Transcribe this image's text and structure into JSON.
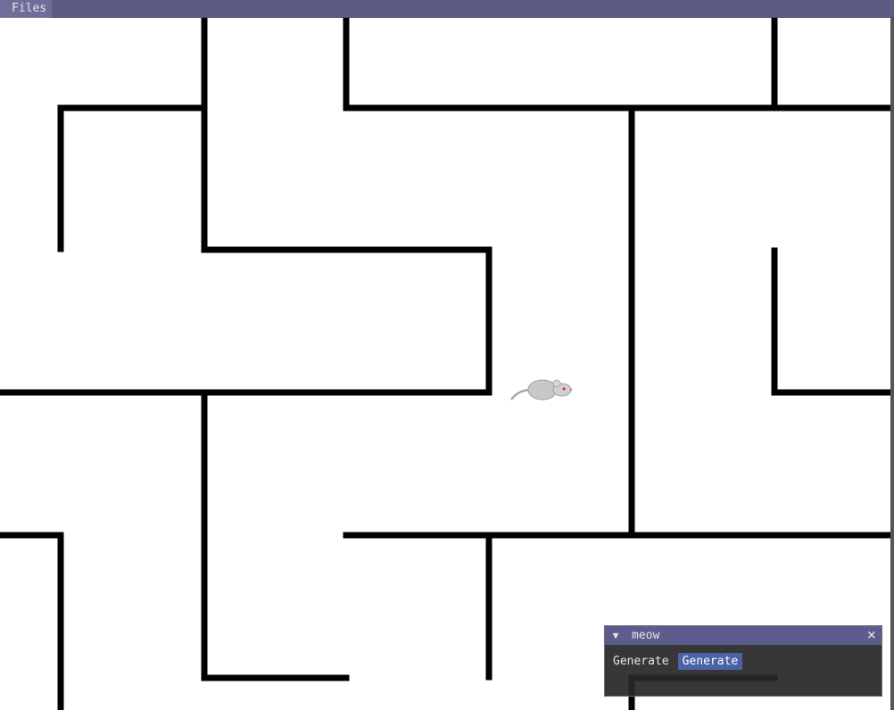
{
  "menubar": {
    "files_label": "Files"
  },
  "panel": {
    "title": "meow",
    "collapse_icon": "▼",
    "close_icon": "×",
    "label": "Generate",
    "button_label": "Generate"
  },
  "maze": {
    "grid": {
      "cols": 7,
      "rows": 5
    },
    "wall_color": "#000000",
    "background_color": "#ffffff",
    "mouse": {
      "col": 3,
      "row": 2,
      "facing": "right",
      "body_color": "#c8c8c8",
      "eye_color": "#e03030"
    }
  }
}
